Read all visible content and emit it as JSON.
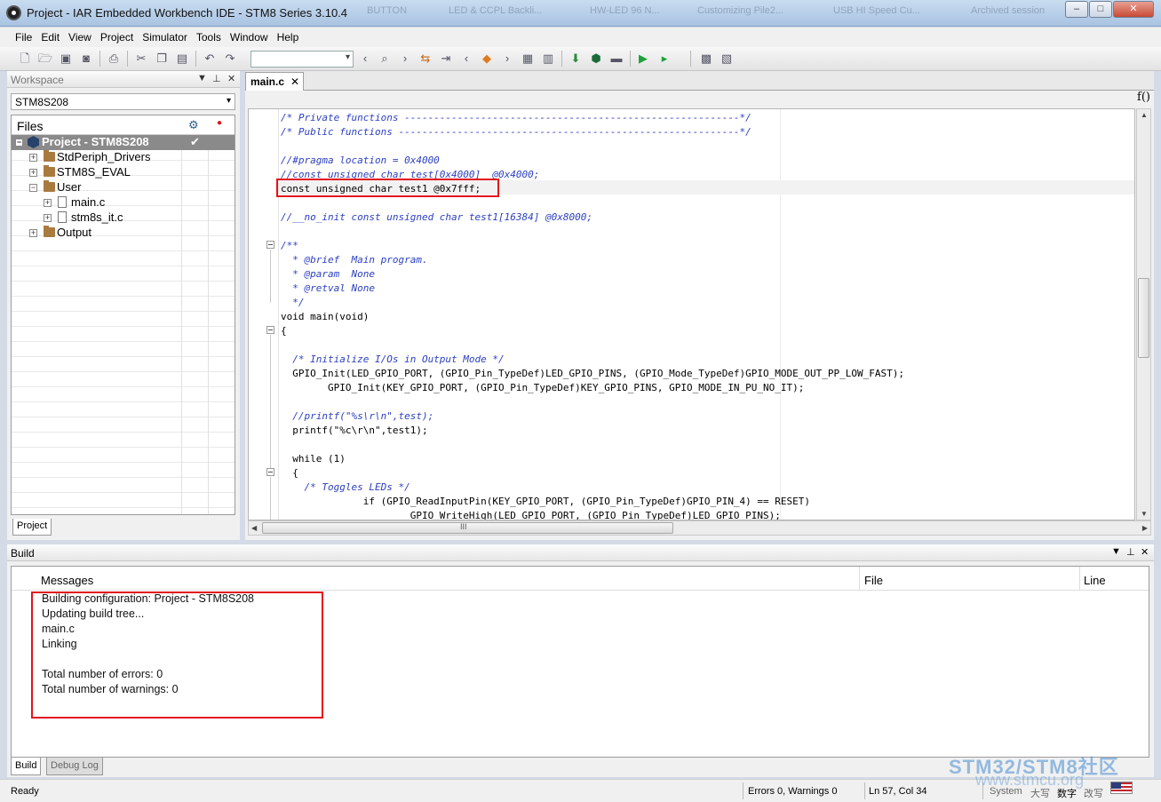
{
  "window": {
    "title": "Project - IAR Embedded Workbench IDE - STM8 Series 3.10.4",
    "taskbar_ghosts": [
      "BUTTON",
      "LED & CCPL Backli...",
      "HW-LED 96 N...",
      "Customizing Pile2...",
      "USB HI Speed Cu...",
      "Archived session"
    ],
    "minimize": "‒",
    "maximize": "□",
    "close": "✕"
  },
  "menu": [
    "File",
    "Edit",
    "View",
    "Project",
    "Simulator",
    "Tools",
    "Window",
    "Help"
  ],
  "workspace": {
    "title": "Workspace",
    "config": "STM8S208",
    "files_header": "Files",
    "check": "✔",
    "dot": "●",
    "tree": [
      {
        "label": "Project - STM8S208",
        "type": "project"
      },
      {
        "label": "StdPeriph_Drivers",
        "type": "folder"
      },
      {
        "label": "STM8S_EVAL",
        "type": "folder"
      },
      {
        "label": "User",
        "type": "folder"
      },
      {
        "label": "main.c",
        "type": "file"
      },
      {
        "label": "stm8s_it.c",
        "type": "file"
      },
      {
        "label": "Output",
        "type": "folder"
      }
    ],
    "tab": "Project"
  },
  "editor": {
    "tab": "main.c",
    "tab_close": "✕",
    "fx": "f()",
    "lines": [
      {
        "text": "/* Private functions ---------------------------------------------------------*/",
        "kind": "comment"
      },
      {
        "text": "/* Public functions ----------------------------------------------------------*/",
        "kind": "comment"
      },
      {
        "text": "",
        "kind": "code"
      },
      {
        "text": "//#pragma location = 0x4000",
        "kind": "comment"
      },
      {
        "text": "//const unsigned char test[0x4000]  @0x4000;",
        "kind": "comment"
      },
      {
        "text": "const unsigned char test1 @0x7fff;",
        "kind": "code"
      },
      {
        "text": "",
        "kind": "code"
      },
      {
        "text": "//__no_init const unsigned char test1[16384] @0x8000;",
        "kind": "comment"
      },
      {
        "text": "",
        "kind": "code"
      },
      {
        "text": "/**",
        "kind": "comment"
      },
      {
        "text": "  * @brief  Main program.",
        "kind": "comment"
      },
      {
        "text": "  * @param  None",
        "kind": "comment"
      },
      {
        "text": "  * @retval None",
        "kind": "comment"
      },
      {
        "text": "  */",
        "kind": "comment"
      },
      {
        "text": "void main(void)",
        "kind": "code"
      },
      {
        "text": "{",
        "kind": "code"
      },
      {
        "text": "",
        "kind": "code"
      },
      {
        "text": "  /* Initialize I/Os in Output Mode */",
        "kind": "comment"
      },
      {
        "text": "  GPIO_Init(LED_GPIO_PORT, (GPIO_Pin_TypeDef)LED_GPIO_PINS, (GPIO_Mode_TypeDef)GPIO_MODE_OUT_PP_LOW_FAST);",
        "kind": "code"
      },
      {
        "text": "        GPIO_Init(KEY_GPIO_PORT, (GPIO_Pin_TypeDef)KEY_GPIO_PINS, GPIO_MODE_IN_PU_NO_IT);",
        "kind": "code"
      },
      {
        "text": "",
        "kind": "code"
      },
      {
        "text": "  //printf(\"%s\\r\\n\",test);",
        "kind": "comment"
      },
      {
        "text": "  printf(\"%c\\r\\n\",test1);",
        "kind": "code"
      },
      {
        "text": "",
        "kind": "code"
      },
      {
        "text": "  while (1)",
        "kind": "code"
      },
      {
        "text": "  {",
        "kind": "code"
      },
      {
        "text": "    /* Toggles LEDs */",
        "kind": "comment"
      },
      {
        "text": "              if (GPIO_ReadInputPin(KEY_GPIO_PORT, (GPIO_Pin_TypeDef)GPIO_PIN_4) == RESET)",
        "kind": "code"
      },
      {
        "text": "                      GPIO_WriteHigh(LED_GPIO_PORT, (GPIO_Pin_TypeDef)LED_GPIO_PINS);",
        "kind": "code"
      }
    ],
    "scroll_grip": "III",
    "arrows": {
      "left": "◀",
      "right": "▶"
    }
  },
  "build": {
    "title": "Build",
    "columns": {
      "messages": "Messages",
      "file": "File",
      "line": "Line"
    },
    "messages": [
      "Building configuration: Project - STM8S208",
      "Updating build tree...",
      "main.c",
      "Linking",
      "",
      "Total number of errors: 0",
      "Total number of warnings: 0"
    ],
    "tabs": [
      "Build",
      "Debug Log"
    ]
  },
  "status": {
    "ready": "Ready",
    "errors": "Errors 0, Warnings 0",
    "position": "Ln 57, Col 34",
    "system": "System",
    "ime": [
      "大写",
      "数字",
      "改写"
    ]
  },
  "watermark": {
    "line1": "STM32/STM8社区",
    "line2": "www.stmcu.org"
  },
  "colors": {
    "comment": "#2b3fc2",
    "highlight_box": "#e3141b",
    "selected_row": "#8a8a8a"
  }
}
